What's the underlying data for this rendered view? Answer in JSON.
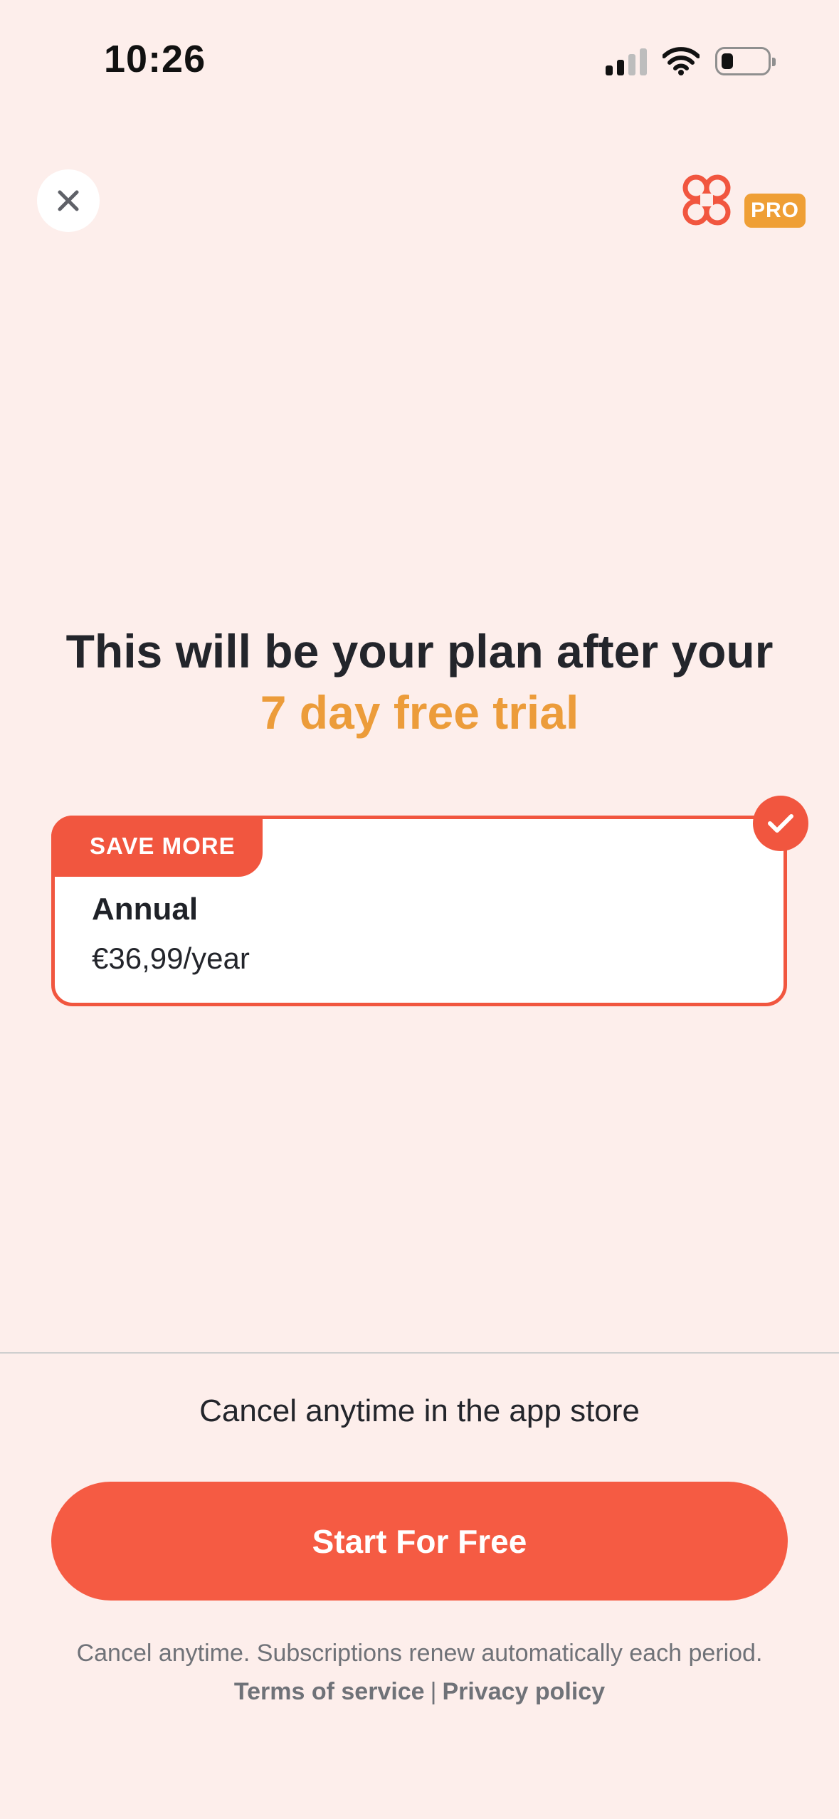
{
  "status_bar": {
    "time": "10:26",
    "icons": [
      "cellular-signal-icon",
      "wifi-icon",
      "battery-icon"
    ]
  },
  "header": {
    "close_icon": "close-icon",
    "logo_icon": "clover-logo-icon",
    "badge": "PRO"
  },
  "headline": {
    "line1": "This will be your plan after your",
    "line2": "7 day free trial"
  },
  "plan": {
    "tag": "SAVE MORE",
    "name": "Annual",
    "price": "€36,99/year",
    "selected": true
  },
  "footer": {
    "cancel_note": "Cancel anytime in the app store",
    "cta_label": "Start For Free",
    "fine_print": "Cancel anytime. Subscriptions renew automatically each period.",
    "terms_label": "Terms of service",
    "separator": "|",
    "privacy_label": "Privacy policy"
  },
  "colors": {
    "background": "#fdeeeb",
    "accent": "#f1563f",
    "highlight": "#ec9c3a",
    "text": "#23252b",
    "muted": "#6f7278"
  }
}
